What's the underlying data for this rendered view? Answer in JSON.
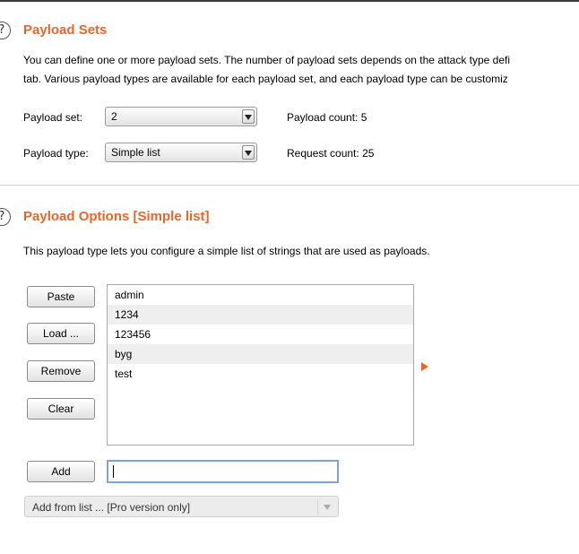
{
  "payload_sets": {
    "help_icon": "?",
    "title": "Payload Sets",
    "description_line1": "You can define one or more payload sets. The number of payload sets depends on the attack type defi",
    "description_line2": "tab. Various payload types are available for each payload set, and each payload type can be customiz",
    "set_label": "Payload set:",
    "set_value": "2",
    "type_label": "Payload type:",
    "type_value": "Simple list",
    "count_label": "Payload count:",
    "count_value": "5",
    "request_label": "Request count:",
    "request_value": "25"
  },
  "payload_options": {
    "help_icon": "?",
    "title": "Payload Options [Simple list]",
    "description": "This payload type lets you configure a simple list of strings that are used as payloads.",
    "buttons": {
      "paste": "Paste",
      "load": "Load ...",
      "remove": "Remove",
      "clear": "Clear",
      "add": "Add"
    },
    "items": [
      "admin",
      "1234",
      "123456",
      "byg",
      "test"
    ],
    "add_input_value": "",
    "add_from_list": "Add from list ... [Pro version only]"
  },
  "colors": {
    "accent": "#e8662a",
    "input_focus": "#7aa6d6",
    "alt_row": "#efefef"
  },
  "icons": {
    "help": "question-circle-icon",
    "dropdown": "chevron-down-icon",
    "move": "play-arrow-icon"
  }
}
